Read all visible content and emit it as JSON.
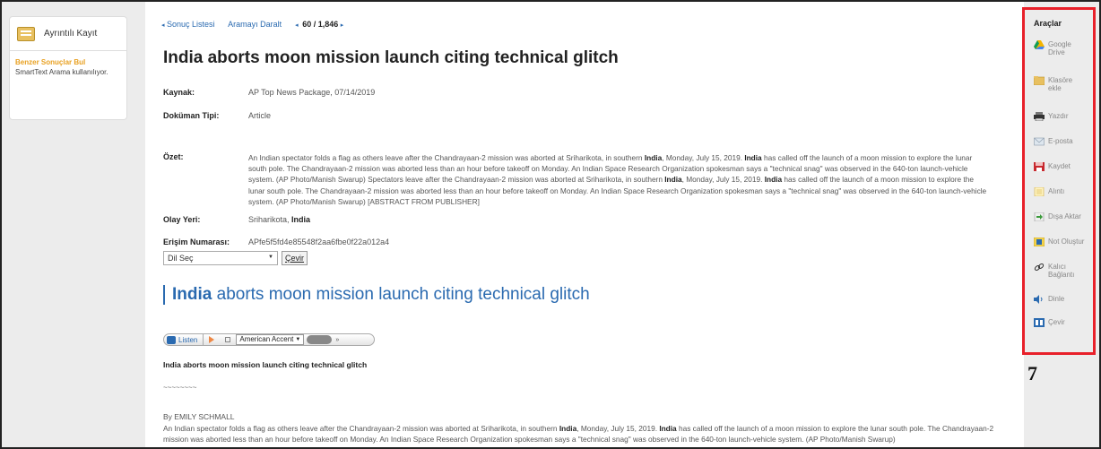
{
  "left_panel": {
    "detail_label": "Ayrıntılı Kayıt",
    "similar_title": "Benzer Sonuçlar Bul",
    "similar_sub": "SmartText Arama kullanılıyor."
  },
  "crumb": {
    "results_list": "Sonuç Listesi",
    "refine": "Aramayı Daralt",
    "count": "60 / 1,846"
  },
  "article": {
    "title": "India aborts moon mission launch citing technical glitch",
    "source_key": "Kaynak:",
    "source_val": "AP Top News Package, 07/14/2019",
    "doctype_key": "Doküman Tipi:",
    "doctype_val": "Article",
    "abstract_key": "Özet:",
    "abstract_1": "An Indian spectator folds a flag as others leave after the Chandrayaan-2 mission was aborted at Sriharikota, in southern ",
    "hl": "India",
    "abstract_2": ", Monday, July 15, 2019. ",
    "abstract_3": " has called off the launch of a moon mission to explore the lunar south pole. The Chandrayaan-2 mission was aborted less than an hour before takeoff on Monday. An Indian Space Research Organization spokesman says a \"technical snag\" was observed in the 640-ton launch-vehicle system. (AP Photo/Manish Swarup) Spectators leave after the Chandrayaan-2 mission was aborted at Sriharikota, in southern ",
    "abstract_4": " has called off the launch of a moon mission to explore the lunar south pole. The Chandrayaan-2 mission was aborted less than an hour before takeoff on Monday. An Indian Space Research Organization spokesman says a \"technical snag\" was observed in the 640-ton launch-vehicle system. (AP Photo/Manish Swarup) [ABSTRACT FROM PUBLISHER]",
    "location_key": "Olay Yeri:",
    "location_val": "Sriharikota, ",
    "access_key": "Erişim Numarası:",
    "access_val": "APfe5f5fd4e85548f2aa6fbe0f22a012a4",
    "lang_select": "Dil Seç",
    "translate": "Çevir",
    "h2_rest": " aborts moon mission launch citing technical glitch",
    "subtitle": "India aborts moon mission launch citing technical glitch",
    "tilde": "~~~~~~~~",
    "byline": "By EMILY SCHMALL",
    "body_1": "An Indian spectator folds a flag as others leave after the Chandrayaan-2 mission was aborted at Sriharikota, in southern ",
    "body_2": ", Monday, July 15, 2019. ",
    "body_3": " has called off the launch of a moon mission to explore the lunar south pole. The Chandrayaan-2 mission was aborted less than an hour before takeoff on Monday. An Indian Space Research Organization spokesman says a \"technical snag\" was observed in the 640-ton launch-vehicle system. (AP Photo/Manish Swarup)"
  },
  "listen": {
    "label": "Listen",
    "accent": "American Accent"
  },
  "tools": {
    "header": "Araçlar",
    "items": [
      {
        "label": "Google\nDrive",
        "icon": "google-drive-icon"
      },
      {
        "label": "Klasöre\nekle",
        "icon": "folder-icon"
      },
      {
        "label": "Yazdır",
        "icon": "print-icon"
      },
      {
        "label": "E-posta",
        "icon": "email-icon"
      },
      {
        "label": "Kaydet",
        "icon": "save-icon"
      },
      {
        "label": "Alıntı",
        "icon": "cite-icon"
      },
      {
        "label": "Dışa Aktar",
        "icon": "export-icon"
      },
      {
        "label": "Not Oluştur",
        "icon": "note-icon"
      },
      {
        "label": "Kalıcı\nBağlantı",
        "icon": "permalink-icon"
      },
      {
        "label": "Dinle",
        "icon": "listen-icon"
      },
      {
        "label": "Çevir",
        "icon": "translate-icon"
      }
    ]
  },
  "annotation": "7",
  "colors": {
    "accent": "#2a6ab0",
    "highlight_box": "#e8202a",
    "similar_title": "#e8a020"
  }
}
